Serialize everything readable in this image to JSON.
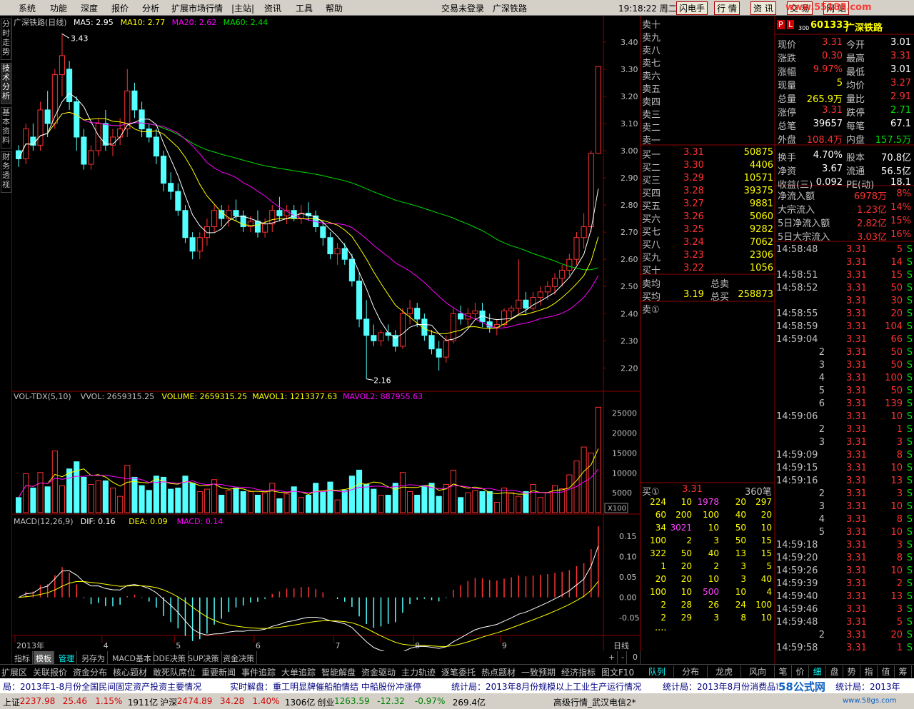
{
  "menu": [
    "系统",
    "功能",
    "深度",
    "报价",
    "分析",
    "扩展市场行情",
    "|主站|",
    "资讯",
    "工具",
    "帮助"
  ],
  "menu_status": [
    "交易未登录",
    "广深铁路"
  ],
  "clock": "19:18:22 周二",
  "top_buttons": [
    "闪电手",
    "行 情",
    "资 讯",
    "交 易",
    "网 站"
  ],
  "watermark": "www.55188.com",
  "left_tabs": [
    "分时走势",
    "技术分析",
    "基本资料",
    "财务透视"
  ],
  "colors": {
    "up": "#ff3232",
    "down": "#54ffff",
    "ma5": "#ffffff",
    "ma10": "#ffff00",
    "ma20": "#ff00ff",
    "ma60": "#00e000",
    "grid": "#8b0000",
    "axis": "#c0c0c0"
  },
  "main": {
    "title": "广深铁路(日线)",
    "legend": [
      {
        "t": "MA5: 2.95",
        "c": "#ffffff"
      },
      {
        "t": "MA10: 2.77",
        "c": "#ffff00"
      },
      {
        "t": "MA20: 2.62",
        "c": "#ff00ff"
      },
      {
        "t": "MA60: 2.44",
        "c": "#00e000"
      }
    ],
    "high_label": "3.43",
    "low_label": "2.16",
    "y_ticks": [
      "3.40",
      "3.30",
      "3.20",
      "3.10",
      "3.00",
      "2.90",
      "2.80",
      "2.70",
      "2.60",
      "2.50",
      "2.40",
      "2.30",
      "2.20"
    ]
  },
  "vol": {
    "legend": [
      {
        "t": "VOL-TDX(5,10)",
        "c": "#c0c0c0"
      },
      {
        "t": "VVOL: 2659315.25",
        "c": "#c0c0c0"
      },
      {
        "t": "VOLUME: 2659315.25",
        "c": "#ffff00"
      },
      {
        "t": "MAVOL1: 1213377.63",
        "c": "#ffff00"
      },
      {
        "t": "MAVOL2: 887955.63",
        "c": "#ff00ff"
      }
    ],
    "y_ticks": [
      "25000",
      "20000",
      "15000",
      "10000",
      "5000"
    ],
    "unit": "X100"
  },
  "macd": {
    "legend": [
      {
        "t": "MACD(12,26,9)",
        "c": "#c0c0c0"
      },
      {
        "t": "DIF: 0.16",
        "c": "#ffffff"
      },
      {
        "t": "DEA: 0.09",
        "c": "#ffff00"
      },
      {
        "t": "MACD: 0.14",
        "c": "#ff00ff"
      }
    ],
    "y_ticks": [
      "0.15",
      "0.10",
      "0.05",
      "0.00",
      "-0.05"
    ]
  },
  "x_labels": [
    "2013年",
    "4",
    "5",
    "6",
    "7",
    "8",
    "9"
  ],
  "period": "日线",
  "chart_data": {
    "type": "candlestick",
    "title": "广深铁路(日线)",
    "ylim": [
      2.13,
      3.46
    ],
    "note": "daily OHLC, estimated from image",
    "candles": [
      [
        3.0,
        3.02,
        2.94,
        2.97
      ],
      [
        2.97,
        3.1,
        2.95,
        3.08
      ],
      [
        3.05,
        3.1,
        3.0,
        3.02
      ],
      [
        3.02,
        3.18,
        3.0,
        3.15
      ],
      [
        3.15,
        3.22,
        3.05,
        3.1
      ],
      [
        3.1,
        3.3,
        3.08,
        3.28
      ],
      [
        3.28,
        3.43,
        3.2,
        3.35
      ],
      [
        3.3,
        3.33,
        3.15,
        3.18
      ],
      [
        3.18,
        3.2,
        3.0,
        3.05
      ],
      [
        3.05,
        3.08,
        2.93,
        2.95
      ],
      [
        2.95,
        3.02,
        2.93,
        3.0
      ],
      [
        3.0,
        3.12,
        2.98,
        3.1
      ],
      [
        3.1,
        3.15,
        3.0,
        3.02
      ],
      [
        3.02,
        3.08,
        2.98,
        3.05
      ],
      [
        3.05,
        3.12,
        3.02,
        3.08
      ],
      [
        3.08,
        3.3,
        3.05,
        3.22
      ],
      [
        3.22,
        3.25,
        3.12,
        3.15
      ],
      [
        3.15,
        3.18,
        3.05,
        3.08
      ],
      [
        3.08,
        3.1,
        3.03,
        3.05
      ],
      [
        3.05,
        3.08,
        2.95,
        2.98
      ],
      [
        2.98,
        3.0,
        2.85,
        2.88
      ],
      [
        2.88,
        2.92,
        2.82,
        2.85
      ],
      [
        2.85,
        2.88,
        2.76,
        2.78
      ],
      [
        2.78,
        2.8,
        2.66,
        2.68
      ],
      [
        2.68,
        2.7,
        2.6,
        2.63
      ],
      [
        2.63,
        2.7,
        2.6,
        2.68
      ],
      [
        2.68,
        2.75,
        2.65,
        2.72
      ],
      [
        2.72,
        2.8,
        2.7,
        2.78
      ],
      [
        2.78,
        2.8,
        2.72,
        2.75
      ],
      [
        2.75,
        2.8,
        2.72,
        2.78
      ],
      [
        2.78,
        2.82,
        2.74,
        2.76
      ],
      [
        2.76,
        2.78,
        2.7,
        2.72
      ],
      [
        2.72,
        2.76,
        2.7,
        2.74
      ],
      [
        2.74,
        2.78,
        2.68,
        2.7
      ],
      [
        2.7,
        2.75,
        2.68,
        2.73
      ],
      [
        2.73,
        2.8,
        2.7,
        2.78
      ],
      [
        2.78,
        2.83,
        2.74,
        2.76
      ],
      [
        2.76,
        2.8,
        2.73,
        2.78
      ],
      [
        2.78,
        2.8,
        2.74,
        2.75
      ],
      [
        2.75,
        2.8,
        2.73,
        2.77
      ],
      [
        2.77,
        2.81,
        2.74,
        2.76
      ],
      [
        2.76,
        2.78,
        2.7,
        2.72
      ],
      [
        2.72,
        2.74,
        2.65,
        2.68
      ],
      [
        2.68,
        2.7,
        2.6,
        2.62
      ],
      [
        2.62,
        2.66,
        2.58,
        2.64
      ],
      [
        2.64,
        2.66,
        2.58,
        2.6
      ],
      [
        2.6,
        2.62,
        2.5,
        2.52
      ],
      [
        2.52,
        2.55,
        2.35,
        2.38
      ],
      [
        2.38,
        2.45,
        2.16,
        2.32
      ],
      [
        2.32,
        2.36,
        2.28,
        2.3
      ],
      [
        2.3,
        2.34,
        2.28,
        2.33
      ],
      [
        2.33,
        2.36,
        2.3,
        2.32
      ],
      [
        2.32,
        2.34,
        2.26,
        2.28
      ],
      [
        2.28,
        2.42,
        2.27,
        2.4
      ],
      [
        2.4,
        2.45,
        2.36,
        2.42
      ],
      [
        2.42,
        2.44,
        2.35,
        2.38
      ],
      [
        2.38,
        2.4,
        2.3,
        2.32
      ],
      [
        2.32,
        2.34,
        2.25,
        2.27
      ],
      [
        2.27,
        2.3,
        2.19,
        2.24
      ],
      [
        2.24,
        2.32,
        2.22,
        2.3
      ],
      [
        2.3,
        2.42,
        2.29,
        2.4
      ],
      [
        2.4,
        2.43,
        2.36,
        2.38
      ],
      [
        2.38,
        2.42,
        2.35,
        2.4
      ],
      [
        2.4,
        2.44,
        2.38,
        2.41
      ],
      [
        2.41,
        2.44,
        2.35,
        2.37
      ],
      [
        2.37,
        2.4,
        2.33,
        2.35
      ],
      [
        2.35,
        2.38,
        2.32,
        2.36
      ],
      [
        2.36,
        2.42,
        2.35,
        2.41
      ],
      [
        2.41,
        2.43,
        2.38,
        2.42
      ],
      [
        2.42,
        2.6,
        2.4,
        2.45
      ],
      [
        2.45,
        2.48,
        2.4,
        2.42
      ],
      [
        2.42,
        2.48,
        2.41,
        2.46
      ],
      [
        2.46,
        2.5,
        2.43,
        2.48
      ],
      [
        2.48,
        2.52,
        2.45,
        2.5
      ],
      [
        2.5,
        2.55,
        2.47,
        2.53
      ],
      [
        2.53,
        2.58,
        2.5,
        2.56
      ],
      [
        2.56,
        2.62,
        2.54,
        2.6
      ],
      [
        2.6,
        2.7,
        2.58,
        2.68
      ],
      [
        2.68,
        2.77,
        2.64,
        2.72
      ],
      [
        2.72,
        3.0,
        2.7,
        2.99
      ],
      [
        2.99,
        3.31,
        2.99,
        3.31
      ]
    ]
  },
  "quote": {
    "code": "601333",
    "name": "广深铁路",
    "badges": [
      "P",
      "L",
      "300"
    ],
    "rows": [
      [
        [
          "现价",
          "3.31",
          "#ff3232"
        ],
        [
          "今开",
          "3.01",
          "#ffffff"
        ]
      ],
      [
        [
          "涨跌",
          "0.30",
          "#ff3232"
        ],
        [
          "最高",
          "3.31",
          "#ff3232"
        ]
      ],
      [
        [
          "涨幅",
          "9.97%",
          "#ff3232"
        ],
        [
          "最低",
          "3.01",
          "#ffffff"
        ]
      ],
      [
        [
          "现量",
          "5",
          "#ffff00"
        ],
        [
          "均价",
          "3.27",
          "#ff3232"
        ]
      ],
      [
        [
          "总量",
          "265.9万",
          "#ffff00"
        ],
        [
          "量比",
          "2.91",
          "#ff3232"
        ]
      ],
      [
        [
          "涨停",
          "3.31",
          "#ff3232"
        ],
        [
          "跌停",
          "2.71",
          "#00e000"
        ]
      ],
      [
        [
          "总笔",
          "39657",
          "#ffffff"
        ],
        [
          "每笔",
          "67.1",
          "#ffffff"
        ]
      ],
      [
        [
          "外盘",
          "108.4万",
          "#ff3232"
        ],
        [
          "内盘",
          "157.5万",
          "#00e000"
        ]
      ],
      [
        [
          "换手",
          "4.70%",
          "#ffffff"
        ],
        [
          "股本",
          "70.8亿",
          "#ffffff"
        ]
      ],
      [
        [
          "净资",
          "3.67",
          "#ffffff"
        ],
        [
          "流通",
          "56.5亿",
          "#ffffff"
        ]
      ],
      [
        [
          "收益(三)",
          "0.092",
          "#ffffff"
        ],
        [
          "PE(动)",
          "18.1",
          "#ffffff"
        ]
      ]
    ],
    "flows": [
      [
        "净流入额",
        "6978万",
        "8%"
      ],
      [
        "大宗流入",
        "1.23亿",
        "14%"
      ],
      [
        "5日净流入额",
        "2.82亿",
        "15%"
      ],
      [
        "5日大宗流入",
        "3.03亿",
        "16%"
      ]
    ]
  },
  "sells": [
    "卖十",
    "卖九",
    "卖八",
    "卖七",
    "卖六",
    "卖五",
    "卖四",
    "卖三",
    "卖二",
    "卖一"
  ],
  "buys": [
    [
      "买一",
      "3.31",
      "50875"
    ],
    [
      "买二",
      "3.30",
      "4406"
    ],
    [
      "买三",
      "3.29",
      "10571"
    ],
    [
      "买四",
      "3.28",
      "39375"
    ],
    [
      "买五",
      "3.27",
      "9881"
    ],
    [
      "买六",
      "3.26",
      "5060"
    ],
    [
      "买七",
      "3.25",
      "9282"
    ],
    [
      "买八",
      "3.24",
      "7062"
    ],
    [
      "买九",
      "3.23",
      "2306"
    ],
    [
      "买十",
      "3.22",
      "1056"
    ]
  ],
  "avg": {
    "sell_label": "卖均",
    "sell_total": "总卖",
    "buy_label": "买均",
    "buy_price": "3.19",
    "buy_total_label": "总买",
    "buy_total": "258873",
    "queue_label": "卖①"
  },
  "buy_queue": {
    "label": "买①",
    "price": "3.31",
    "count": "360笔",
    "rows": [
      [
        "224",
        "10",
        "1978",
        "20",
        "297"
      ],
      [
        "60",
        "200",
        "100",
        "40",
        "20"
      ],
      [
        "34",
        "3021",
        "10",
        "50",
        "10"
      ],
      [
        "100",
        "2",
        "3",
        "50",
        "15"
      ],
      [
        "322",
        "50",
        "40",
        "13",
        "15"
      ],
      [
        "1",
        "20",
        "2",
        "3",
        "5"
      ],
      [
        "20",
        "20",
        "10",
        "3",
        "40"
      ],
      [
        "100",
        "10",
        "500",
        "10",
        "4"
      ],
      [
        "2",
        "28",
        "26",
        "24",
        "100"
      ],
      [
        "2",
        "29",
        "3",
        "8",
        "10"
      ]
    ],
    "more": "...."
  },
  "ticks": [
    [
      "14:58:48",
      "3.31",
      "5"
    ],
    [
      "",
      "3.31",
      "14"
    ],
    [
      "14:58:51",
      "3.31",
      "15"
    ],
    [
      "14:58:52",
      "3.31",
      "50"
    ],
    [
      "",
      "3.31",
      "30"
    ],
    [
      "14:58:55",
      "3.31",
      "20"
    ],
    [
      "14:58:59",
      "3.31",
      "104"
    ],
    [
      "14:59:04",
      "3.31",
      "66"
    ],
    [
      "2",
      "3.31",
      "50"
    ],
    [
      "3",
      "3.31",
      "50"
    ],
    [
      "4",
      "3.31",
      "100"
    ],
    [
      "5",
      "3.31",
      "50"
    ],
    [
      "6",
      "3.31",
      "139"
    ],
    [
      "14:59:06",
      "3.31",
      "10"
    ],
    [
      "2",
      "3.31",
      "1"
    ],
    [
      "3",
      "3.31",
      "3"
    ],
    [
      "14:59:09",
      "3.31",
      "8"
    ],
    [
      "14:59:15",
      "3.31",
      "10"
    ],
    [
      "14:59:16",
      "3.31",
      "13"
    ],
    [
      "2",
      "3.31",
      "3"
    ],
    [
      "3",
      "3.31",
      "10"
    ],
    [
      "4",
      "3.31",
      "8"
    ],
    [
      "5",
      "3.31",
      "10"
    ],
    [
      "14:59:18",
      "3.31",
      "3"
    ],
    [
      "14:59:20",
      "3.31",
      "8"
    ],
    [
      "14:59:26",
      "3.31",
      "10"
    ],
    [
      "14:59:39",
      "3.31",
      "2"
    ],
    [
      "14:59:40",
      "3.31",
      "13"
    ],
    [
      "14:59:46",
      "3.31",
      "3"
    ],
    [
      "14:59:48",
      "3.31",
      "5"
    ],
    [
      "2",
      "3.31",
      "20"
    ],
    [
      "14:59:58",
      "3.31",
      "1"
    ]
  ],
  "tick_flag": "S",
  "bottom_tabs": [
    "指标",
    "模板",
    "管理",
    "另存为",
    "MACD基本",
    "DDE决策",
    "SUP决策",
    "资金决策"
  ],
  "nav_tabs": [
    "扩展区",
    "关联报价",
    "资金分布",
    "核心题材",
    "敢死队席位",
    "重要新闻",
    "事件追踪",
    "大单追踪",
    "智能解盘",
    "资金驱动",
    "主力轨迹",
    "逐笔委托",
    "热点题材",
    "一致预期",
    "经济指标",
    "图文F10"
  ],
  "right_tabs1": [
    "队列",
    "分布",
    "龙虎",
    "风向"
  ],
  "right_tabs2": [
    "笔",
    "价",
    "细",
    "盘",
    "势",
    "指",
    "值",
    "筹"
  ],
  "news": [
    "局：2013年1-8月份全国民间固定资产投资主要情况",
    "实时解盘：重工明显牌催船舶情结 中船股份冲涨停",
    "统计局：2013年8月份规模以上工业生产运行情况",
    "统计局：2013年8月份消费品市场情况",
    "统计局：2013年"
  ],
  "status": [
    {
      "t": "上证",
      "c": "#000"
    },
    {
      "t": "2237.98",
      "c": "#d00000"
    },
    {
      "t": "25.46",
      "c": "#d00000"
    },
    {
      "t": "1.15%",
      "c": "#d00000"
    },
    {
      "t": "1911亿",
      "c": "#000"
    },
    {
      "t": "沪深",
      "c": "#000"
    },
    {
      "t": "2474.89",
      "c": "#d00000"
    },
    {
      "t": "34.28",
      "c": "#d00000"
    },
    {
      "t": "1.40%",
      "c": "#d00000"
    },
    {
      "t": "1306亿",
      "c": "#000"
    },
    {
      "t": "创业",
      "c": "#000"
    },
    {
      "t": "1263.59",
      "c": "#008000"
    },
    {
      "t": "-12.32",
      "c": "#008000"
    },
    {
      "t": "-0.97%",
      "c": "#008000"
    },
    {
      "t": "269.4亿",
      "c": "#000"
    }
  ],
  "status_right": "高级行情_武汉电信2*",
  "site_logo": "58公式网",
  "site_url": "www.58gs.com"
}
